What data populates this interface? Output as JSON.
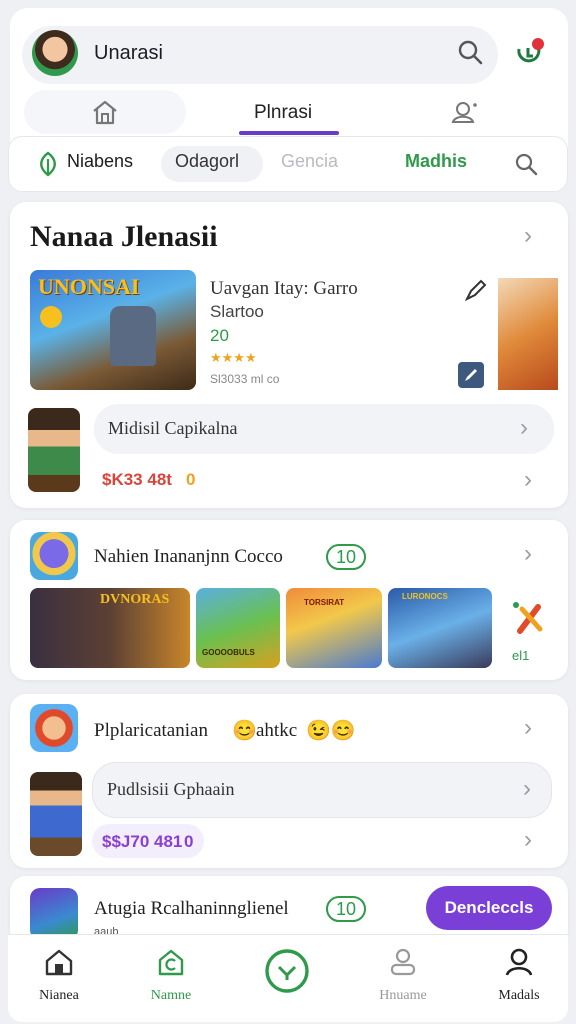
{
  "header": {
    "username": "Unarasi"
  },
  "tabs": {
    "active": "Plnrasi"
  },
  "filters": [
    "Niabens",
    "Odagorl",
    "Gencia",
    "Madhis"
  ],
  "section1": {
    "title": "Nanaa Jlenasii",
    "game": {
      "banner_text": "UNONSAI",
      "name": "Uavgan Itay: Garro",
      "subtitle": "Slartoo",
      "rating_num": "20",
      "rating": 4,
      "meta": "Sl3033 ml co"
    },
    "row_label": "Midisil Capikalna",
    "price": "$K33 48t",
    "price_suffix": "0"
  },
  "section2": {
    "title": "Nahien Inananjnn Cocco",
    "badge": "10",
    "thumbs": [
      "DVNORAS",
      "GOOOOBULS",
      "TORSIRAT",
      "LURONOCS"
    ],
    "end_label": "el1"
  },
  "section3": {
    "title": "Plplaricatanian",
    "title_suffix": "ahtkc",
    "row_label": "Pudlsisii Gphaain",
    "price": "$$J70 481",
    "price_suffix": "0"
  },
  "section4": {
    "title": "Atugia Rcalhaninnglienel",
    "badge": "10",
    "button": "Dencleccls",
    "sublabel": "aaub"
  },
  "bottom_nav": [
    {
      "label": "Nianea"
    },
    {
      "label": "Namne"
    },
    {
      "label": ""
    },
    {
      "label": "Hnuame"
    },
    {
      "label": "Madals"
    }
  ],
  "colors": {
    "accent": "#6a3cc8",
    "green": "#2e9a4a",
    "price_red": "#d9453b",
    "price_purple": "#8b3fd1"
  }
}
